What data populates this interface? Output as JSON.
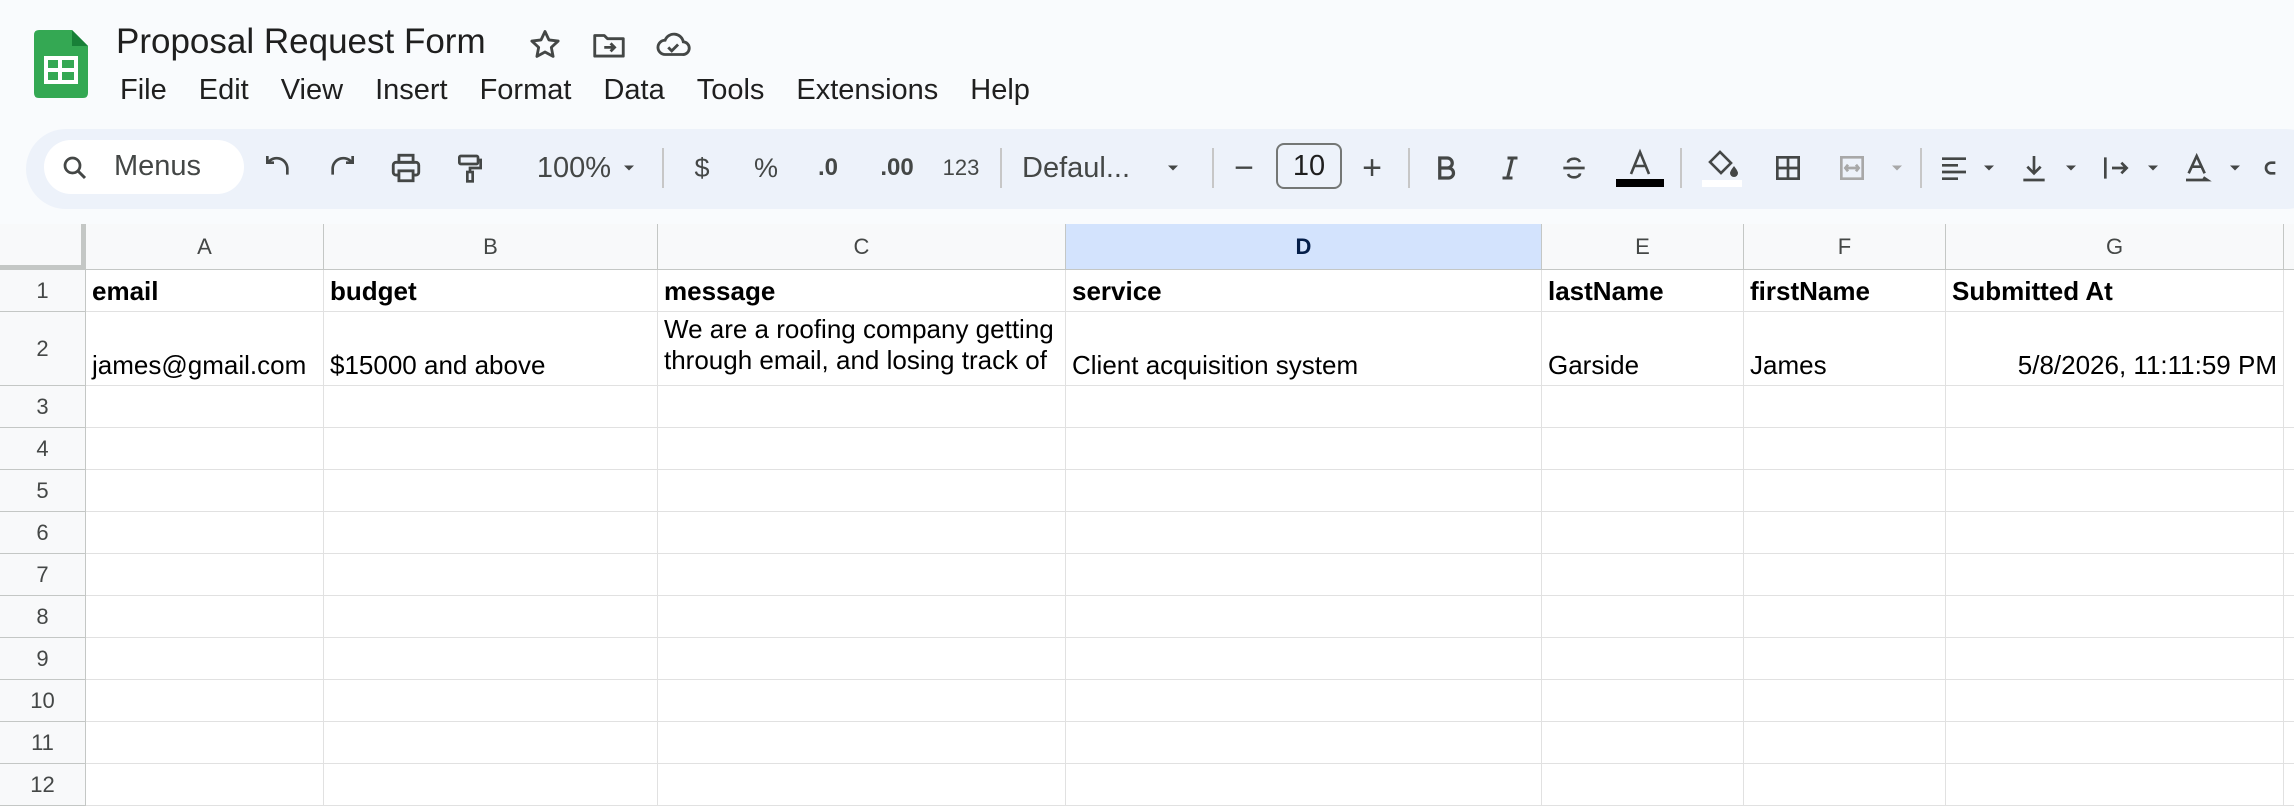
{
  "doc": {
    "title": "Proposal Request Form"
  },
  "menu": [
    "File",
    "Edit",
    "View",
    "Insert",
    "Format",
    "Data",
    "Tools",
    "Extensions",
    "Help"
  ],
  "toolbar": {
    "search_label": "Menus",
    "zoom": "100%",
    "currency": "$",
    "percent": "%",
    "decrease_decimal": ".0",
    "increase_decimal": ".00",
    "number_format": "123",
    "font": "Defaul...",
    "font_size": "10",
    "minus": "−",
    "plus": "+"
  },
  "columns": [
    "A",
    "B",
    "C",
    "D",
    "E",
    "F",
    "G"
  ],
  "selected_column": "D",
  "rows": [
    "1",
    "2",
    "3",
    "4",
    "5",
    "6",
    "7",
    "8",
    "9",
    "10",
    "11",
    "12"
  ],
  "table": {
    "header": [
      "email",
      "budget",
      "message",
      "service",
      "lastName",
      "firstName",
      "Submitted At"
    ],
    "row2": [
      "james@gmail.com",
      "$15000 and above",
      "We are a roofing company getting through email, and losing track of",
      "Client acquisition system",
      "Garside",
      "James",
      "5/8/2026, 11:11:59 PM"
    ]
  },
  "colors": {
    "sheets_green": "#34a853",
    "selected_col": "#d3e3fd",
    "toolbar_bg": "#edf2fa"
  }
}
